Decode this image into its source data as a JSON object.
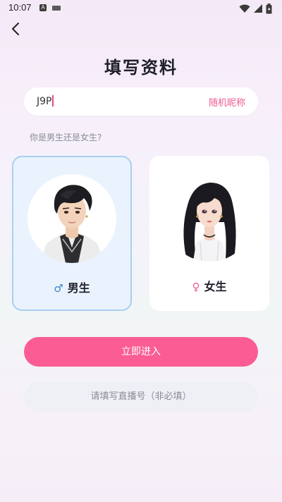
{
  "status_bar": {
    "time": "10:07",
    "notif_letter": "A"
  },
  "page": {
    "title": "填写资料"
  },
  "nickname": {
    "value": "J9P",
    "random_label": "随机昵称"
  },
  "gender": {
    "question": "你是男生还是女生?",
    "options": [
      {
        "label": "男生",
        "symbol": "♂",
        "selected": true
      },
      {
        "label": "女生",
        "symbol": "♀",
        "selected": false
      }
    ]
  },
  "actions": {
    "enter_label": "立即进入"
  },
  "live_number": {
    "placeholder": "请填写直播号（非必填）"
  },
  "colors": {
    "accent_pink": "#fb5c93",
    "selected_border": "#a9cff0",
    "selected_bg": "#eaf3fd"
  }
}
